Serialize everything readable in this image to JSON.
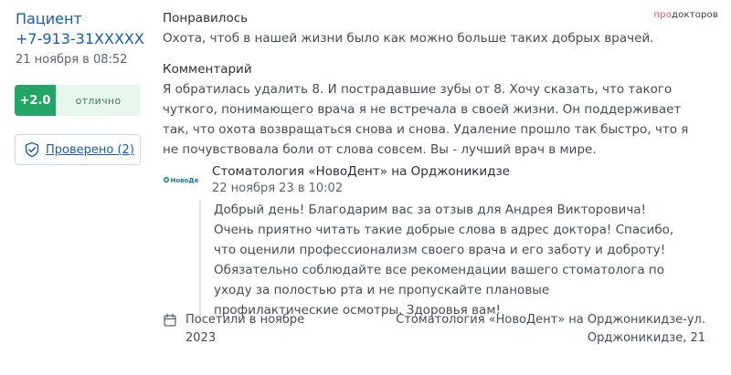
{
  "author": {
    "name": "Пациент",
    "phone": "+7-913-31XXXXX",
    "date": "21 ноября в 08:52"
  },
  "rating": {
    "score": "+2.0",
    "label": "отлично",
    "score_color": "#23a566"
  },
  "verified": {
    "label": "Проверено (2)",
    "icon": "shield-check-icon"
  },
  "brand": {
    "part1": "про",
    "part2": "докторов"
  },
  "liked": {
    "title": "Понравилось",
    "text": "Охота, чтоб в нашей жизни было как можно больше таких добрых врачей."
  },
  "comment": {
    "title": "Комментарий",
    "text": "Я обратилась удалить 8. И пострадавшие зубы от 8. Хочу сказать, что такого чуткого, понимающего врача я не встречала в своей жизни. Он поддерживает так, что охота возвращаться снова и снова. Удаление прошло так быстро, что я не почувствовала боли от слова совсем. Вы - лучший врач в мире."
  },
  "reply": {
    "clinic_logo_text": "НовоДент",
    "clinic": "Стоматология «НовоДент» на Орджоникидзе",
    "date": "22 ноября 23 в 10:02",
    "text": "Добрый день! Благодарим вас за отзыв для Андрея Викторовича! Очень приятно читать такие добрые слова в адрес доктора! Спасибо, что оценили профессионализм своего врача и его заботу и доброту! Обязательно соблюдайте все рекомендации вашего стоматолога по уходу за полостью рта и не пропускайте плановые профилактические осмотры. Здоровья вам!"
  },
  "visit": {
    "icon": "calendar-icon",
    "text": "Посетили в ноябре 2023"
  },
  "clinic_address": "Стоматология «НовоДент» на Орджоникидзе-ул. Орджоникидзе, 21"
}
